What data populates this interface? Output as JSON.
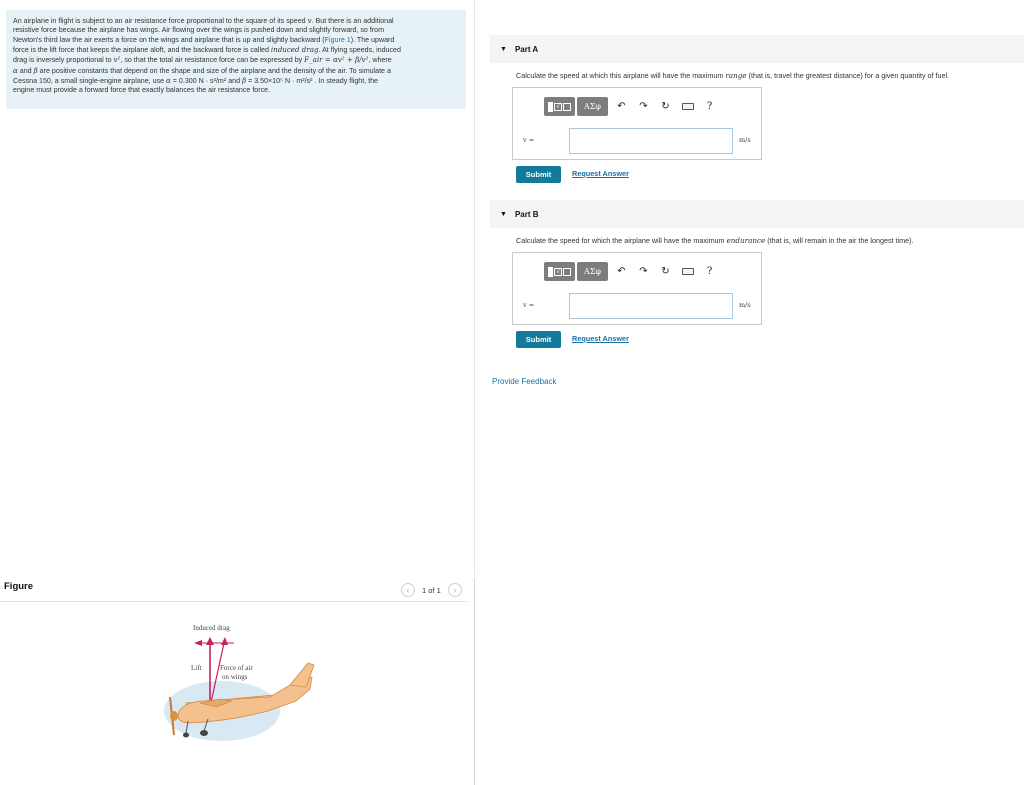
{
  "problem": {
    "lines": [
      [
        "An airplane in flight is subject to an air resistance force proportional to the square of its speed ",
        "v",
        ". But there is an additional"
      ],
      [
        "resistive force because the airplane has wings. Air flowing over the wings is pushed down and slightly forward, so from"
      ],
      [
        "Newton's third law the air exerts a force on the wings and airplane that is up and slightly backward (",
        "Figure 1",
        "). The upward"
      ],
      [
        "force is the lift force that keeps the airplane aloft, and the backward force is called ",
        "induced drag",
        ". At flying speeds, induced"
      ],
      [
        "drag is inversely proportional to ",
        "v²",
        ", so that the total air resistance force can be expressed by ",
        "F_air = αv² + β/v²",
        ", where"
      ],
      [
        "α",
        " and ",
        "β",
        " are positive constants that depend on the shape and size of the airplane and the density of the air. To simulate a"
      ],
      [
        "Cessna 150, a small single-engine airplane, use ",
        "α",
        " = 0.300 ",
        "N · s²/m²",
        " and ",
        "β",
        " = 3.50×10⁵ ",
        "N · m²/s²",
        " . In steady flight, the"
      ],
      [
        "engine must provide a forward force that exactly balances the air resistance force."
      ]
    ]
  },
  "figure": {
    "label": "Figure",
    "pager": {
      "prev": "‹",
      "count": "1 of 1",
      "next": "›"
    },
    "annotations": {
      "induced_drag": "Induced drag",
      "lift": "Lift",
      "force_line1": "Force of air",
      "force_line2": "on wings"
    },
    "colors": {
      "plane_body": "#f3c08e",
      "plane_outline": "#d98a3e",
      "arrow": "#c9205a",
      "shadow": "#cfe3f1"
    }
  },
  "parts": [
    {
      "title": "Part A",
      "question_pre": "Calculate the speed at which this airplane will have the maximum ",
      "question_em": "range",
      "question_post": " (that is, travel the greatest distance) for a given quantity of fuel.",
      "var_label": "v =",
      "unit": "m/s",
      "input_value": "",
      "submit": "Submit",
      "request": "Request Answer"
    },
    {
      "title": "Part B",
      "question_pre": "Calculate the speed for which the airplane will have the maximum ",
      "question_em": "endurance",
      "question_post": " (that is, will remain in the air the longest time).",
      "var_label": "v =",
      "unit": "m/s",
      "input_value": "",
      "submit": "Submit",
      "request": "Request Answer"
    }
  ],
  "toolbar": {
    "greek": "ΑΣφ",
    "undo": "↶",
    "redo": "↷",
    "reset": "↻",
    "help": "?"
  },
  "feedback": "Provide Feedback"
}
